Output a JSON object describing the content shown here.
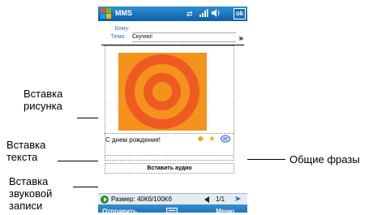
{
  "annotations": {
    "insert_picture": [
      "Вставка",
      "рисунка"
    ],
    "insert_text": [
      "Вставка",
      "текста"
    ],
    "insert_audio": [
      "Вставка",
      "звуковой",
      "записи"
    ],
    "common_phrases": "Общие фразы"
  },
  "titlebar": {
    "app_title": "MMS",
    "ok_label": "ok",
    "icons": [
      "windows-start-icon",
      "connectivity-icon",
      "signal-icon",
      "volume-icon"
    ]
  },
  "fields": {
    "to_label": "Кому:",
    "to_value": "",
    "subject_label": "Тема:",
    "subject_value": "Скучно!"
  },
  "slide": {
    "picture": "orange-concentric-circles-image",
    "text": "С днем рождения!",
    "audio_label": "Вставить аудио",
    "icons": [
      "smiley-icon",
      "star-icon",
      "speech-bubble-icon"
    ]
  },
  "status": {
    "size_text": "Размер: 40Кб/100Кб",
    "page_text": "1/1"
  },
  "softkeys": {
    "left": "Отправить",
    "right": "Меню"
  },
  "colors": {
    "titlebar": "#0d5ea8",
    "picture_background": "#f4931c",
    "picture_rings": "#ef5a23",
    "field_label": "#3a6fc0"
  }
}
